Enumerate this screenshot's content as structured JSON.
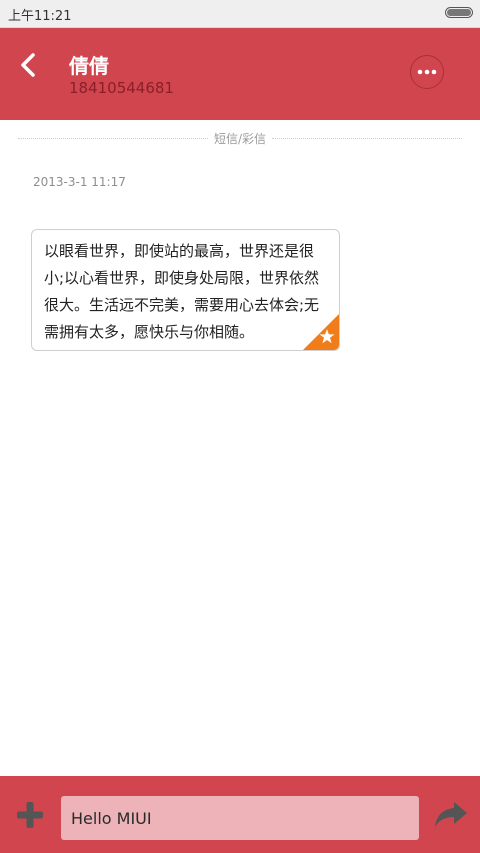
{
  "status_bar": {
    "time": "上午11:21"
  },
  "header": {
    "contact_name": "倩倩",
    "contact_number": "18410544681"
  },
  "divider": {
    "label": "短信/彩信"
  },
  "messages": [
    {
      "timestamp": "2013-3-1 11:17",
      "text": "以眼看世界，即使站的最高，世界还是很小;以心看世界，即使身处局限，世界依然很大。生活远不完美，需要用心去体会;无需拥有太多，愿快乐与你相随。"
    }
  ],
  "composer": {
    "input_value": "Hello MIUI"
  },
  "colors": {
    "accent": "#d1454f",
    "star_badge": "#f07d1a",
    "input_bg": "#edb3b8"
  },
  "icons": {
    "back": "chevron-left-icon",
    "more": "more-dots-icon",
    "star": "star-icon",
    "add": "plus-icon",
    "send": "send-arrow-icon"
  }
}
